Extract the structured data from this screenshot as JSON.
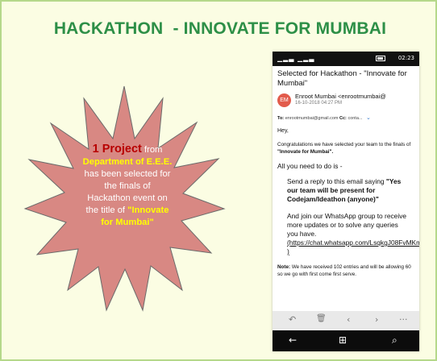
{
  "slide": {
    "title": "HACKATHON  - INNOVATE FOR MUMBAI",
    "star": {
      "line1_highlight": "1 Project",
      "line1_rest": " from",
      "line2": "Department of E.E.E.",
      "line3": "has been selected for",
      "line4": "the finals of",
      "line5": "Hackathon event on",
      "line6_prefix": "the title of ",
      "line6_quote": "\"Innovate",
      "line7": "for Mumbai\""
    },
    "colors": {
      "background": "#fbfde3",
      "title": "#2d8f47",
      "star_fill": "#d88883",
      "highlight_red": "#b80000",
      "highlight_yellow": "#ffff00"
    }
  },
  "phone": {
    "status": {
      "signal": "▁▂▃ ▁▂▃",
      "time": "02:23"
    },
    "email": {
      "subject": "Selected for Hackathon - \"Innovate for Mumbai\"",
      "avatar": "EM",
      "sender": "Enroot Mumbai <enrootmumbai@",
      "date": "16-10-2018 04:27 PM",
      "to_label": "To:",
      "to_value": "enrootmumbai@gmail.com",
      "cc_label": "Cc:",
      "cc_value": "conta...",
      "greeting": "Hey,",
      "congrats_prefix": "Congratulations we have selected your team to the finals of ",
      "congrats_bold": "\"Innovate for Mumbai\".",
      "instruction": "All you need to do is -",
      "step1_prefix": "Send a reply to this email saying ",
      "step1_quote": "\"Yes our team will be present for Codejam/Ideathon (anyone)\"",
      "step2": "And join our WhatsApp group to receive more updates or to solve any queries you have.",
      "step2_link": "(https://chat.whatsapp.com/LsqkgJ08FvMKm2Hr2a7DzU )",
      "note_label": "Note:",
      "note_text": " We have received 102 entries and will be allowing 60 so we go with first come first serve."
    },
    "actions": {
      "reply_icon": "↶",
      "delete_icon": "🗑",
      "prev_icon": "‹",
      "next_icon": "›",
      "more_icon": "···"
    },
    "nav": {
      "back_icon": "←",
      "windows_icon": "⊞",
      "search_icon": "⌕"
    }
  }
}
